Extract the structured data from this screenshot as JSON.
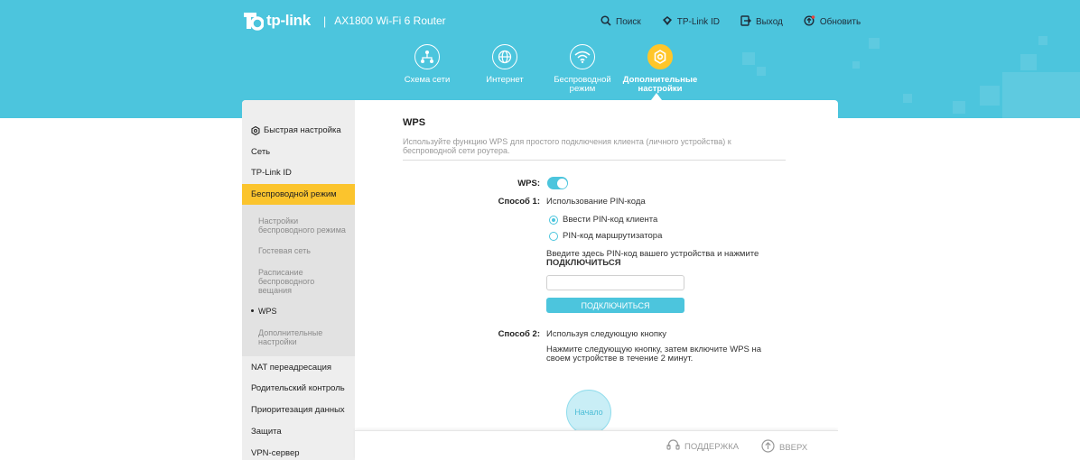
{
  "brand": {
    "logo_text": "tp-link",
    "separator": "|",
    "model": "AX1800 Wi-Fi 6 Router",
    "accent": "#4cc5dd",
    "highlight": "#fbc42d"
  },
  "top_links": [
    {
      "label": "Поиск",
      "icon": "search-icon"
    },
    {
      "label": "TP-Link ID",
      "icon": "tplink-id-icon"
    },
    {
      "label": "Выход",
      "icon": "logout-icon"
    },
    {
      "label": "Обновить",
      "icon": "update-icon"
    }
  ],
  "nav": [
    {
      "label": "Схема сети",
      "icon": "network-map-icon",
      "active": false
    },
    {
      "label": "Интернет",
      "icon": "globe-icon",
      "active": false
    },
    {
      "label": "Беспроводной режим",
      "icon": "wifi-icon",
      "active": false
    },
    {
      "label": "Дополнительные настройки",
      "icon": "gear-icon",
      "active": true
    }
  ],
  "sidebar": {
    "items": [
      {
        "label": "Быстрая настройка",
        "icon": "quick-setup-icon"
      },
      {
        "label": "Сеть"
      },
      {
        "label": "TP-Link ID"
      },
      {
        "label": "Беспроводной режим",
        "active": true
      },
      {
        "label": "NAT переадресация"
      },
      {
        "label": "Родительский контроль"
      },
      {
        "label": "Приоритезация данных"
      },
      {
        "label": "Защита"
      },
      {
        "label": "VPN-сервер"
      }
    ],
    "sub_items": [
      {
        "label": "Настройки беспроводного режима"
      },
      {
        "label": "Гостевая сеть"
      },
      {
        "label": "Расписание беспроводного вещания"
      },
      {
        "label": "WPS",
        "current": true
      },
      {
        "label": "Дополнительные настройки"
      }
    ]
  },
  "wps": {
    "title": "WPS",
    "description": "Используйте функцию WPS для простого подключения клиента (личного устройства) к беспроводной сети роутера.",
    "wps_label": "WPS:",
    "wps_enabled": true,
    "method1_label": "Способ 1:",
    "method1_text": "Использование PIN-кода",
    "radio_client": "Ввести PIN-код клиента",
    "radio_client_checked": true,
    "radio_router": "PIN-код маршрутизатора",
    "radio_router_checked": false,
    "pin_instruction": "Введите здесь PIN-код вашего устройства и нажмите",
    "pin_instruction_bold": "ПОДКЛЮЧИТЬСЯ",
    "pin_value": "",
    "connect_button": "ПОДКЛЮЧИТЬСЯ",
    "method2_label": "Способ 2:",
    "method2_text": "Используя следующую кнопку",
    "method2_instruction": "Нажмите следующую кнопку, затем включите WPS на своем устройстве в течение 2 минут.",
    "start_button": "Начало"
  },
  "footer": {
    "support": "ПОДДЕРЖКА",
    "up": "ВВЕРХ"
  }
}
